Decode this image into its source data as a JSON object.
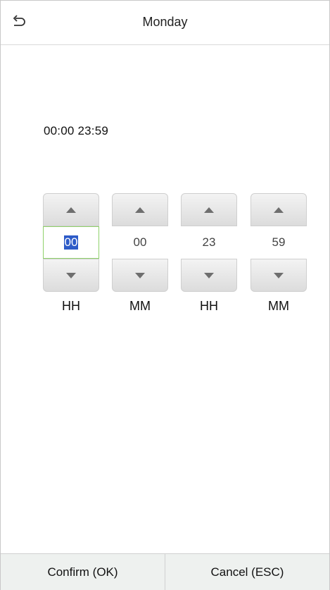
{
  "header": {
    "title": "Monday",
    "back_icon": "undo-arrow-icon"
  },
  "range_text": "00:00  23:59",
  "pickers": [
    {
      "value": "00",
      "unit": "HH",
      "active": true
    },
    {
      "value": "00",
      "unit": "MM",
      "active": false
    },
    {
      "value": "23",
      "unit": "HH",
      "active": false
    },
    {
      "value": "59",
      "unit": "MM",
      "active": false
    }
  ],
  "footer": {
    "confirm_label": "Confirm (OK)",
    "cancel_label": "Cancel (ESC)"
  },
  "colors": {
    "selection": "#2d5bc8",
    "active_border": "#8fd16a",
    "footer_bg": "#eef1ef"
  }
}
